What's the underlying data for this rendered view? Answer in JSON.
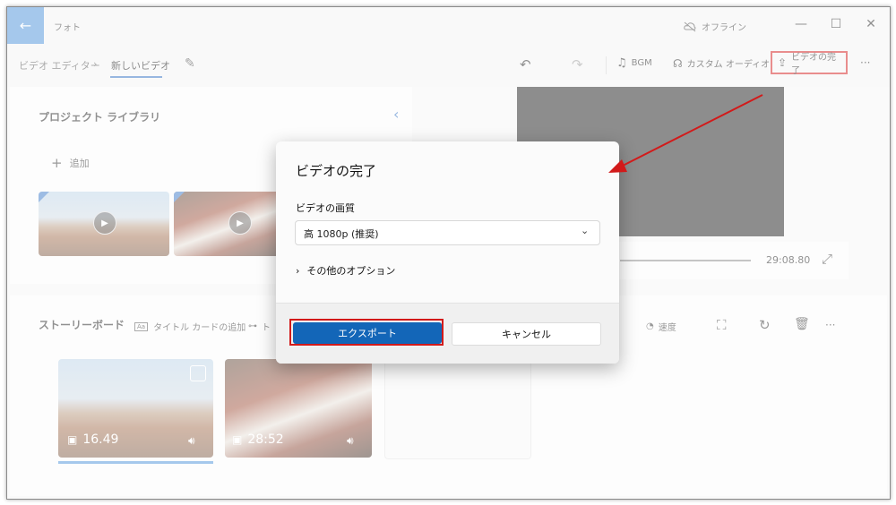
{
  "titlebar": {
    "back_icon": "arrow-left-icon",
    "app_title": "フォト",
    "offline_label": "オフライン",
    "minimize": "—",
    "maximize": "☐",
    "close": "✕"
  },
  "breadcrumb": {
    "parent": "ビデオ エディター",
    "separator": "›",
    "current": "新しいビデオ"
  },
  "toolbar": {
    "undo": "↶",
    "redo": "↷",
    "bgm": "BGM",
    "custom_audio": "カスタム オーディオ",
    "finish_video": "ビデオの完了",
    "more": "···"
  },
  "library": {
    "title": "プロジェクト ライブラリ",
    "collapse": "‹",
    "add": "追加"
  },
  "preview": {
    "time": "29:08.80",
    "fullscreen": "⤢"
  },
  "storyboard": {
    "title": "ストーリーボード",
    "title_card": "タイトル カードの追加",
    "trim_partial": "ト",
    "speed": "速度",
    "more": "···",
    "clips": [
      {
        "duration": "16.49"
      },
      {
        "duration": "28:52"
      }
    ]
  },
  "dialog": {
    "title": "ビデオの完了",
    "quality_label": "ビデオの画質",
    "quality_value": "高 1080p (推奨)",
    "more_options": "その他のオプション",
    "export_button": "エクスポート",
    "cancel_button": "キャンセル"
  },
  "colors": {
    "accent": "#1366b8",
    "highlight": "#d21a1a"
  }
}
